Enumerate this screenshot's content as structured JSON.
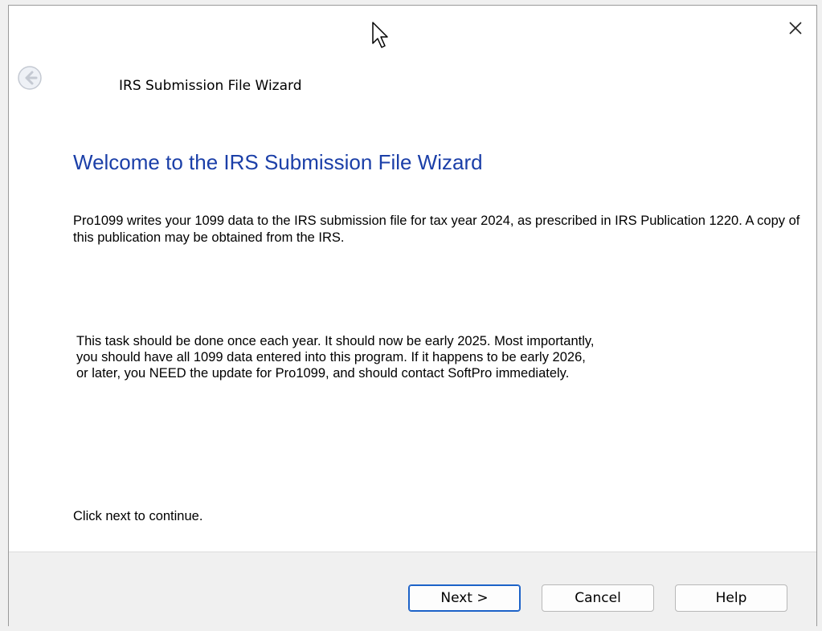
{
  "window": {
    "wizard_title": "IRS Submission File Wizard",
    "close_glyph": "✕"
  },
  "content": {
    "heading": "Welcome to the IRS Submission File Wizard",
    "intro": "Pro1099 writes your 1099 data to the IRS submission file for tax year 2024, as prescribed in IRS Publication 1220. A copy of this publication may be obtained from the IRS.",
    "task": "This task should be done once each year. It should now be early 2025. Most importantly, you should have all 1099 data entered into this program. If it happens to be early 2026, or later, you NEED the update for Pro1099, and should contact SoftPro immediately.",
    "continue": "Click next to continue."
  },
  "buttons": {
    "next": "Next >",
    "cancel": "Cancel",
    "help": "Help"
  },
  "colors": {
    "heading": "#1b3fa8",
    "accent": "#1c62c8"
  },
  "icons": {
    "back": "back-arrow-icon",
    "close": "close-icon",
    "cursor": "mouse-pointer-icon"
  }
}
